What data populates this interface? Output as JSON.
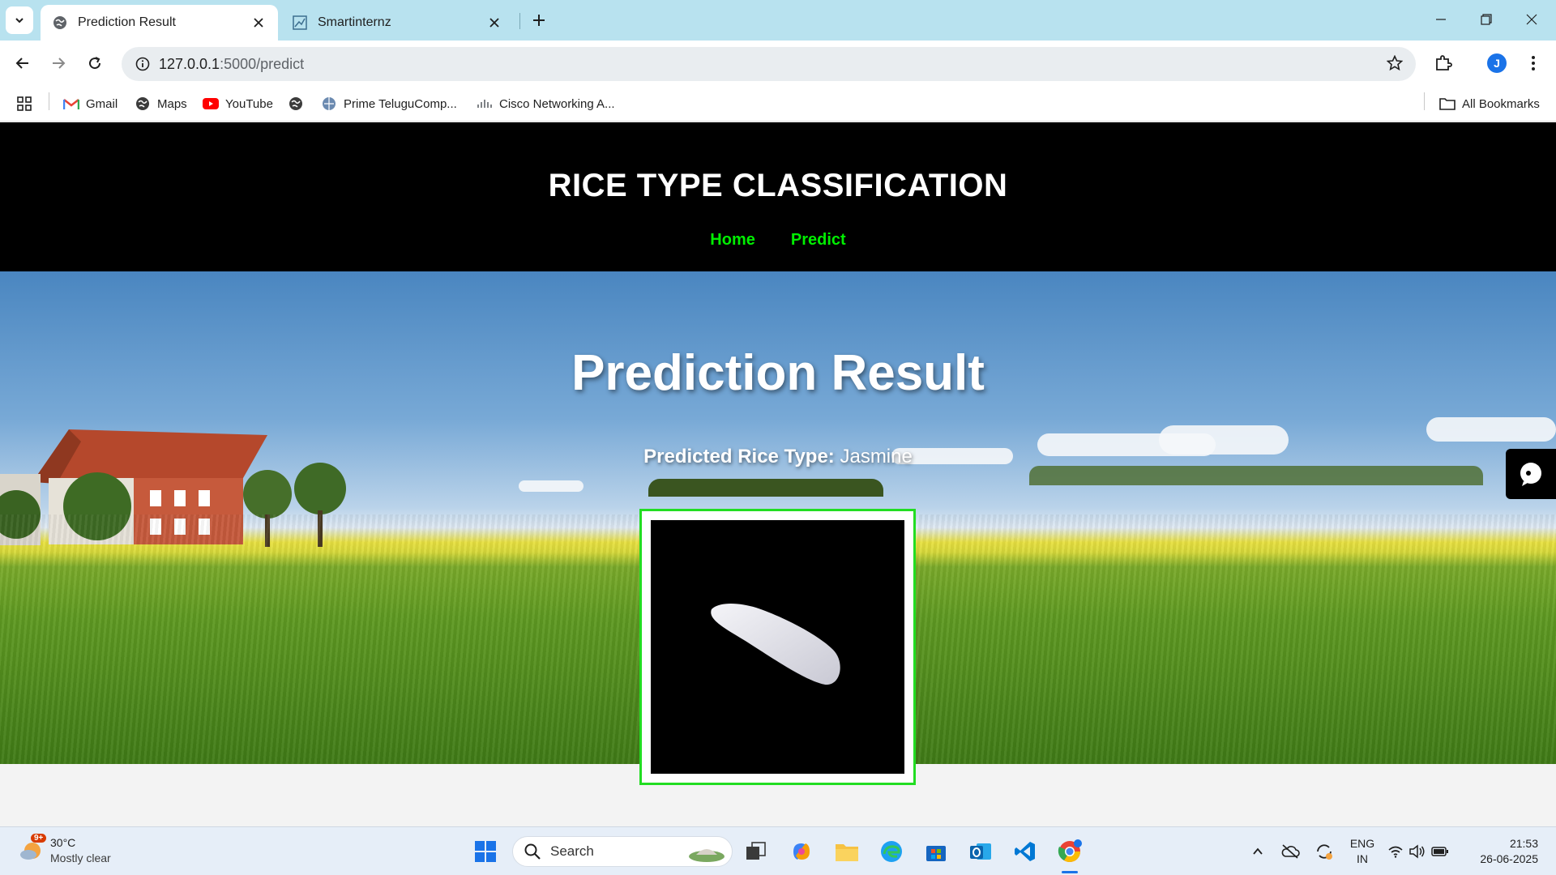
{
  "browser": {
    "tabs": [
      {
        "title": "Prediction Result",
        "active": true
      },
      {
        "title": "Smartinternz",
        "active": false
      }
    ],
    "url_host": "127.0.0.1",
    "url_path": ":5000/predict",
    "profile_initial": "J",
    "bookmarks": [
      {
        "label": "Gmail",
        "icon": "gmail-icon"
      },
      {
        "label": "Maps",
        "icon": "globe-icon"
      },
      {
        "label": "YouTube",
        "icon": "youtube-icon"
      },
      {
        "label": "",
        "icon": "globe-icon"
      },
      {
        "label": "Prime TeluguComp...",
        "icon": "globe-icon"
      },
      {
        "label": "Cisco Networking A...",
        "icon": "cisco-icon"
      }
    ],
    "all_bookmarks_label": "All Bookmarks"
  },
  "page": {
    "site_title": "RICE TYPE CLASSIFICATION",
    "nav": [
      "Home",
      "Predict"
    ],
    "nav_color": "#00ee00",
    "heading": "Prediction Result",
    "result_label": "Predicted Rice Type:",
    "result_value": "Jasmine",
    "image_frame_color": "#22dd22"
  },
  "taskbar": {
    "weather_temp": "30°C",
    "weather_desc": "Mostly clear",
    "weather_badge": "9+",
    "search_placeholder": "Search",
    "lang_primary": "ENG",
    "lang_secondary": "IN",
    "time": "21:53",
    "date": "26-06-2025"
  }
}
